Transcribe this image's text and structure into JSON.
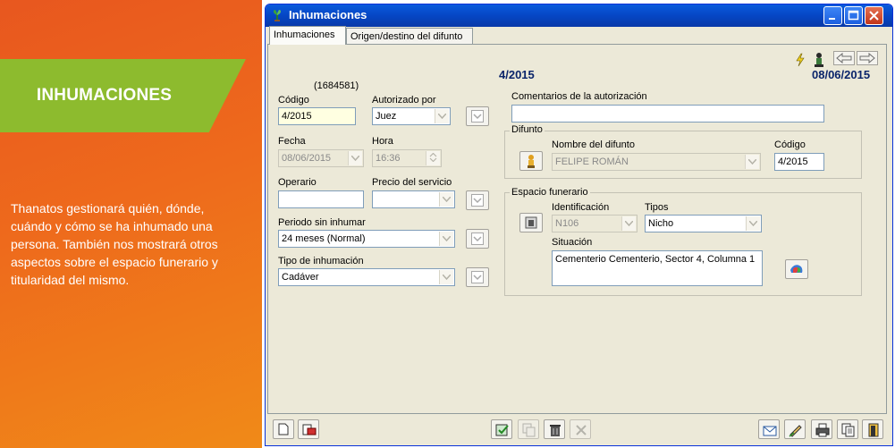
{
  "promo": {
    "title": "INHUMACIONES",
    "description": "Thanatos gestionará quién, dónde, cuándo y cómo se ha inhumado una persona. También nos mostrará otros aspectos sobre el espacio funerario y titularidad del mismo."
  },
  "window": {
    "title": "Inhumaciones",
    "tabs": [
      "Inhumaciones",
      "Origen/destino del difunto"
    ],
    "active_tab": 0
  },
  "header": {
    "id": "(1684581)",
    "number": "4/2015",
    "date": "08/06/2015"
  },
  "form": {
    "codigo": {
      "label": "Código",
      "value": "4/2015"
    },
    "autorizado": {
      "label": "Autorizado por",
      "value": "Juez"
    },
    "fecha": {
      "label": "Fecha",
      "value": "08/06/2015"
    },
    "hora": {
      "label": "Hora",
      "value": "16:36"
    },
    "operario": {
      "label": "Operario",
      "value": ""
    },
    "precio": {
      "label": "Precio del servicio",
      "value": ""
    },
    "periodo": {
      "label": "Periodo sin inhumar",
      "value": "24 meses (Normal)"
    },
    "tipo": {
      "label": "Tipo de inhumación",
      "value": "Cadáver"
    },
    "comentarios": {
      "label": "Comentarios de la autorización",
      "value": ""
    }
  },
  "difunto": {
    "group": "Difunto",
    "nombre_label": "Nombre del difunto",
    "nombre": "FELIPE ROMÁN",
    "codigo_label": "Código",
    "codigo": "4/2015"
  },
  "espacio": {
    "group": "Espacio funerario",
    "ident_label": "Identificación",
    "ident": "N106",
    "tipos_label": "Tipos",
    "tipos": "Nicho",
    "situacion_label": "Situación",
    "situacion": "Cementerio Cementerio, Sector 4, Columna 1"
  },
  "colors": {
    "promo_orange": "#ee6a1c",
    "banner_green": "#8dbb2e",
    "title_blue": "#0a246a",
    "xp_titlebar": "#0646c4"
  }
}
